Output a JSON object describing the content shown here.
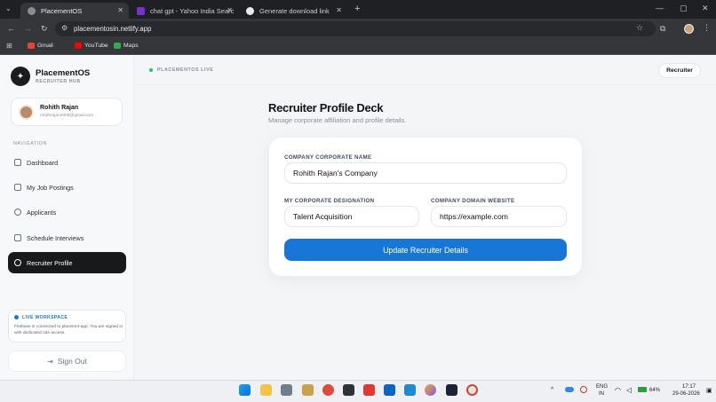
{
  "browser": {
    "tabs": [
      {
        "title": "PlacementOS",
        "active": true,
        "fav_color": "#5f6368"
      },
      {
        "title": "chat gpt - Yahoo India Search R",
        "active": false,
        "fav_color": "#7b2fd1"
      },
      {
        "title": "Generate download link",
        "active": false,
        "fav_color": "#e8eaed"
      }
    ],
    "new_tab_glyph": "+",
    "address": "placementosin.netlify.app",
    "bookmarks": [
      {
        "label": "Gmail",
        "color": "#ea4335"
      },
      {
        "label": "YouTube",
        "color": "#ff0000"
      },
      {
        "label": "Maps",
        "color": "#34a853"
      }
    ]
  },
  "brand": {
    "name": "PlacementOS",
    "subtitle": "RECRUITER HUB"
  },
  "profile": {
    "name": "Rohith Rajan",
    "email": "rohithrajan2008@gmail.com"
  },
  "sidebar": {
    "section_label": "NAVIGATION",
    "items": [
      {
        "label": "Dashboard",
        "icon": "grid-icon"
      },
      {
        "label": "My Job Postings",
        "icon": "briefcase-icon"
      },
      {
        "label": "Applicants",
        "icon": "users-icon"
      },
      {
        "label": "Schedule Interviews",
        "icon": "calendar-icon"
      },
      {
        "label": "Recruiter Profile",
        "icon": "user-icon",
        "active": true
      }
    ],
    "workspace_title": "LIVE WORKSPACE",
    "workspace_text": "Firebase is connected to placemnt-app. You are signed in with dedicated role access.",
    "signout_label": "Sign Out"
  },
  "header": {
    "status": "PLACEMENTOS LIVE",
    "role_badge": "Recruiter"
  },
  "page": {
    "title": "Recruiter Profile Deck",
    "subtitle": "Manage corporate affiliation and profile details."
  },
  "form": {
    "company_label": "COMPANY CORPORATE NAME",
    "company_value": "Rohith Rajan's Company",
    "designation_label": "MY CORPORATE DESIGNATION",
    "designation_value": "Talent Acquisition",
    "website_label": "COMPANY DOMAIN WEBSITE",
    "website_value": "https://example.com",
    "submit_label": "Update Recruiter Details"
  },
  "taskbar": {
    "lang_line1": "ENG",
    "lang_line2": "IN",
    "battery": "64%",
    "time": "17:17",
    "date": "29-06-2026"
  },
  "colors": {
    "accent": "#1877d6",
    "active_nav": "#18191b",
    "live_dot": "#22c55e"
  }
}
